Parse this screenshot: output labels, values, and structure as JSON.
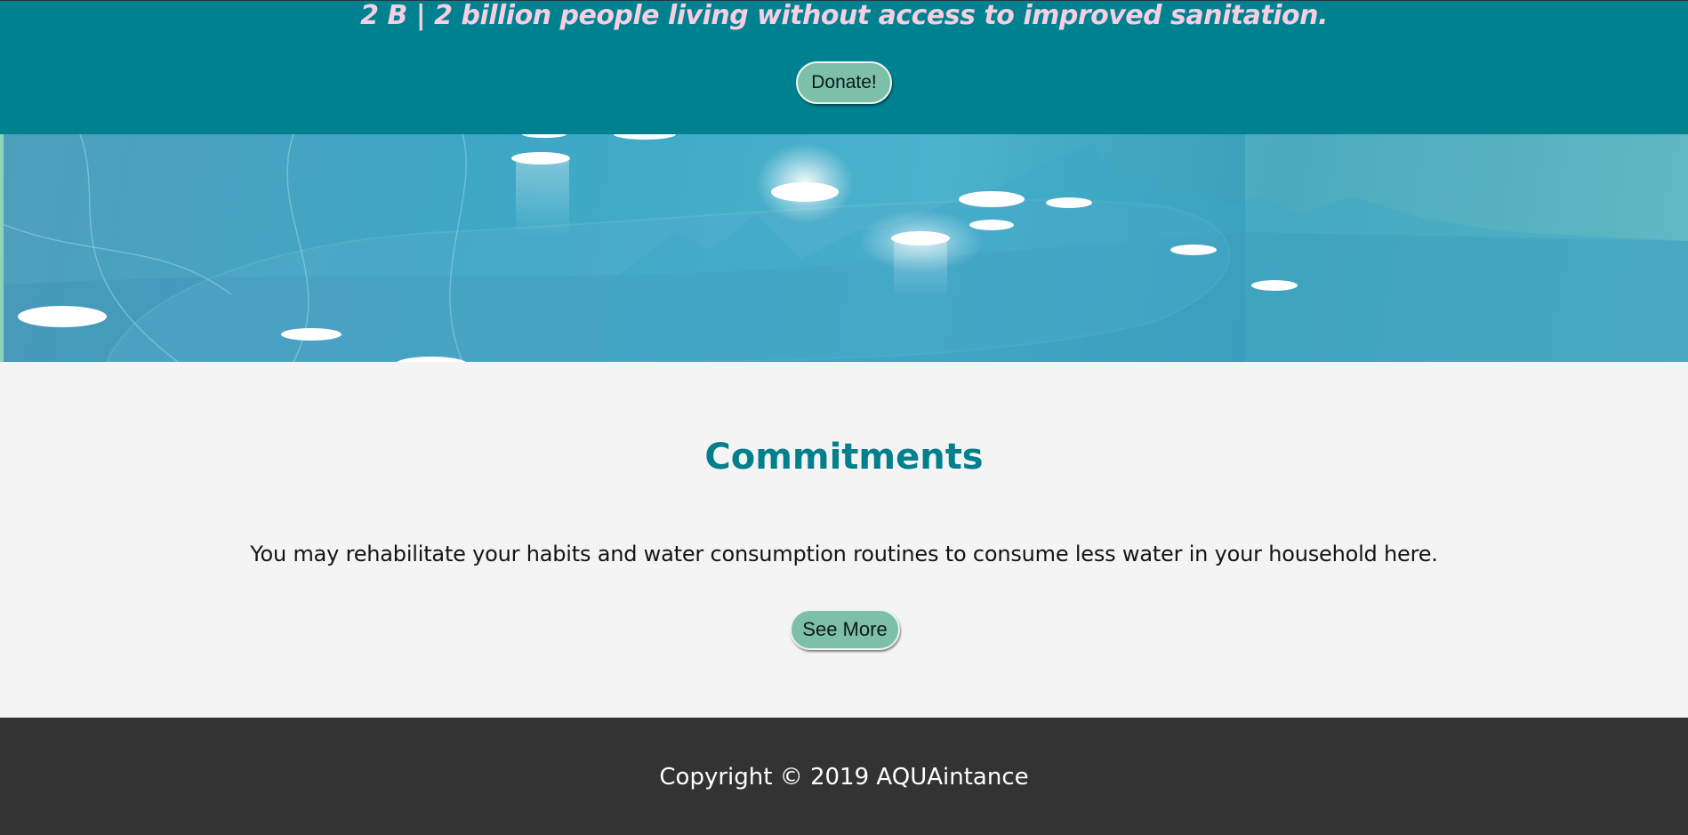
{
  "stat": {
    "text": "2 B | 2 billion people living without access to improved sanitation."
  },
  "donate": {
    "label": "Donate!"
  },
  "banner": {
    "image": "water-droplets-illustration"
  },
  "commitments": {
    "title": "Commitments",
    "text": "You may rehabilitate your habits and water consumption routines to consume less water in your household here.",
    "button_label": "See More"
  },
  "footer": {
    "copyright": "Copyright © 2019 AQUAintance"
  },
  "colors": {
    "teal_band": "#00818f",
    "stat_text": "#f6cfe2",
    "button": "#7ebfaa",
    "title": "#007f8c",
    "footer": "#333333",
    "page_bg": "#f4f4f4"
  }
}
